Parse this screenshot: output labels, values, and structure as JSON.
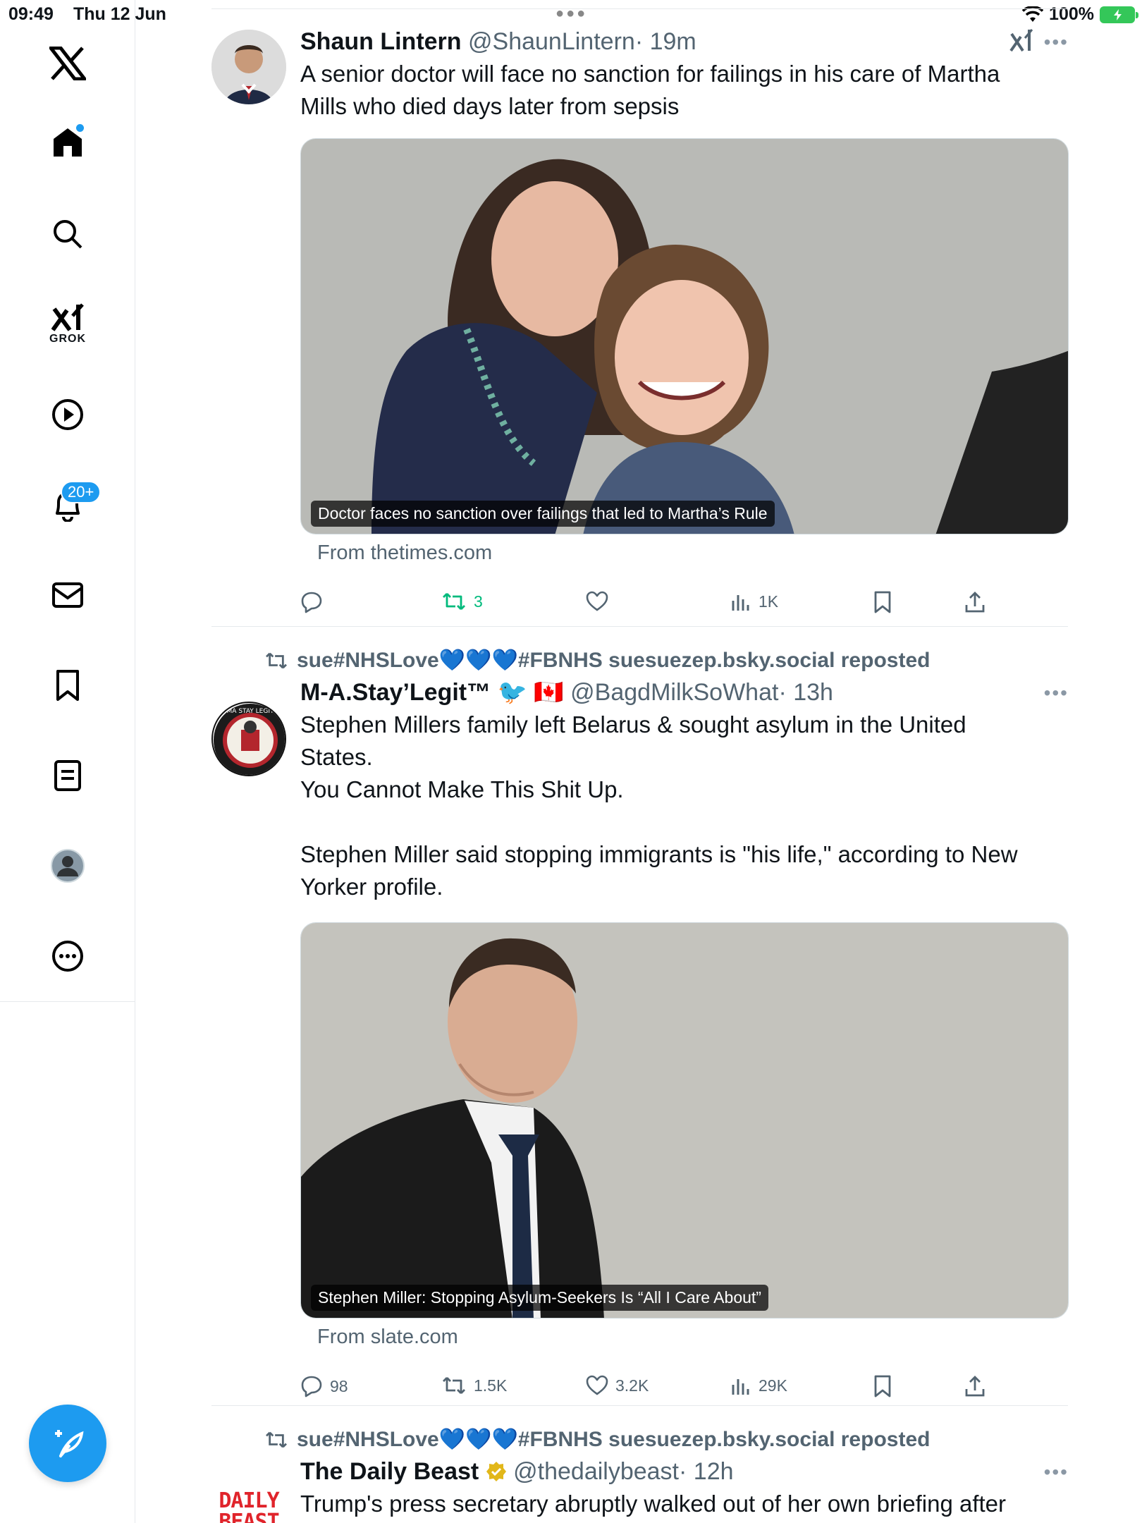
{
  "status_bar": {
    "time": "09:49",
    "date": "Thu 12 Jun",
    "battery": "100%"
  },
  "sidebar": {
    "grok_label": "GROK",
    "notifications_badge": "20+",
    "items": [
      "x-logo",
      "home-icon",
      "search-icon",
      "grok-icon",
      "video-icon",
      "bell-icon",
      "mail-icon",
      "bookmark-icon",
      "list-icon",
      "profile-icon",
      "more-icon"
    ]
  },
  "tweets": [
    {
      "name": "Shaun Lintern",
      "handle": "@ShaunLintern",
      "time": "· 19m",
      "text_lines": [
        "A senior doctor will face no sanction for failings in his care of Martha",
        "Mills who died days later from sepsis"
      ],
      "card_caption": "Doctor faces no sanction over failings that led to Martha’s Rule",
      "from": "From thetimes.com",
      "stats": {
        "replies": "",
        "reposts": "3",
        "likes": "",
        "views": "1K"
      }
    },
    {
      "reposted_by": "sue#NHSLove💙💙💙#FBNHS suesuezep.bsky.social reposted",
      "name": "M-A.Stay’Legit™",
      "flags": "🐦 🇨🇦",
      "handle": "@BagdMilkSoWhat",
      "time": "· 13h",
      "avatar_text": "MA STAY LEGIT",
      "text_lines": [
        "Stephen Millers family left Belarus &  sought asylum in the United",
        "States.",
        "You Cannot Make This Shit Up.",
        "",
        "Stephen Miller said stopping immigrants is \"his life,\" according to New",
        "Yorker profile."
      ],
      "card_caption": "Stephen Miller: Stopping Asylum-Seekers Is “All I Care About”",
      "from": "From slate.com",
      "stats": {
        "replies": "98",
        "reposts": "1.5K",
        "likes": "3.2K",
        "views": "29K"
      }
    },
    {
      "reposted_by": "sue#NHSLove💙💙💙#FBNHS suesuezep.bsky.social reposted",
      "name": "The Daily Beast",
      "handle": "@thedailybeast",
      "time": "· 12h",
      "avatar_text_1": "DAILY",
      "avatar_text_2": "BEAST",
      "text_lines": [
        "Trump's press secretary abruptly walked out of her own briefing after"
      ]
    }
  ],
  "colors": {
    "accent": "#1d9bf0",
    "repost_green": "#00ba7c",
    "muted": "#536471"
  }
}
